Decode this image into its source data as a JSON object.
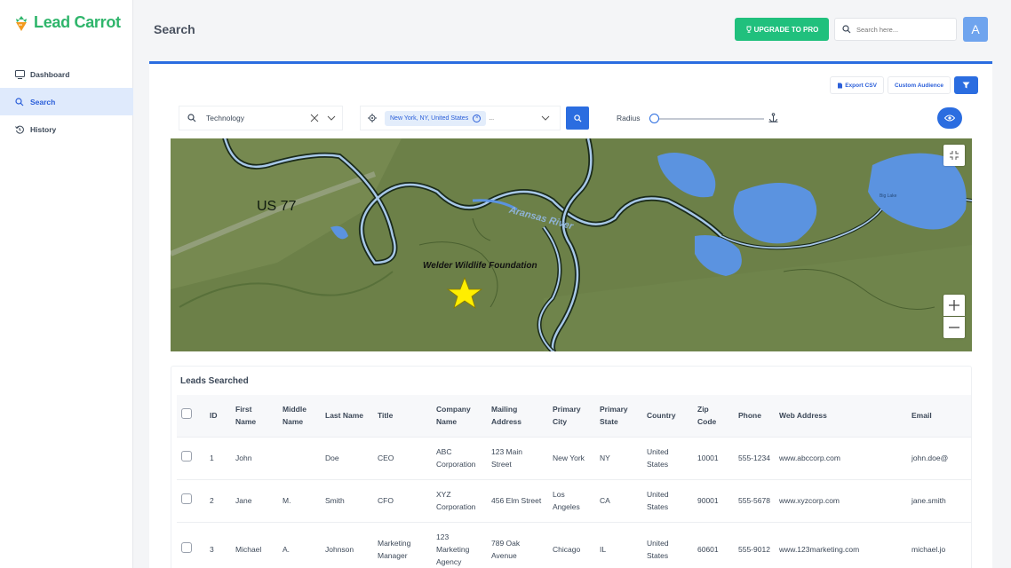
{
  "app": {
    "name": "Lead Carrot"
  },
  "colors": {
    "brand": "#2fb56b",
    "accent": "#2b6de0",
    "upgrade": "#20c07d"
  },
  "sidebar": {
    "items": [
      {
        "label": "Dashboard",
        "icon": "monitor-icon"
      },
      {
        "label": "Search",
        "icon": "search-icon",
        "active": true
      },
      {
        "label": "History",
        "icon": "history-icon"
      }
    ]
  },
  "header": {
    "title": "Search",
    "upgrade_label": "UPGRADE TO PRO",
    "search_placeholder": "Search here...",
    "avatar_letter": "A"
  },
  "actions": {
    "export_label": "Export CSV",
    "audience_label": "Custom Audience"
  },
  "filters": {
    "industry": "Technology",
    "location_chip": "New York, NY, United States",
    "location_more": "...",
    "radius_label": "Radius",
    "radius_value": 0
  },
  "map": {
    "labels": {
      "highway": "US 77",
      "river": "Aransas River",
      "foundation": "Welder Wildlife Foundation",
      "lake": "Big Lake"
    }
  },
  "leads": {
    "title": "Leads Searched",
    "columns": [
      "ID",
      "First Name",
      "Middle Name",
      "Last Name",
      "Title",
      "Company Name",
      "Mailing Address",
      "Primary City",
      "Primary State",
      "Country",
      "Zip Code",
      "Phone",
      "Web Address",
      "Email"
    ],
    "rows": [
      [
        "1",
        "John",
        "",
        "Doe",
        "CEO",
        "ABC Corporation",
        "123 Main Street",
        "New York",
        "NY",
        "United States",
        "10001",
        "555-1234",
        "www.abccorp.com",
        "john.doe@"
      ],
      [
        "2",
        "Jane",
        "M.",
        "Smith",
        "CFO",
        "XYZ Corporation",
        "456 Elm Street",
        "Los Angeles",
        "CA",
        "United States",
        "90001",
        "555-5678",
        "www.xyzcorp.com",
        "jane.smith"
      ],
      [
        "3",
        "Michael",
        "A.",
        "Johnson",
        "Marketing Manager",
        "123 Marketing Agency",
        "789 Oak Avenue",
        "Chicago",
        "IL",
        "United States",
        "60601",
        "555-9012",
        "www.123marketing.com",
        "michael.jo"
      ]
    ]
  }
}
